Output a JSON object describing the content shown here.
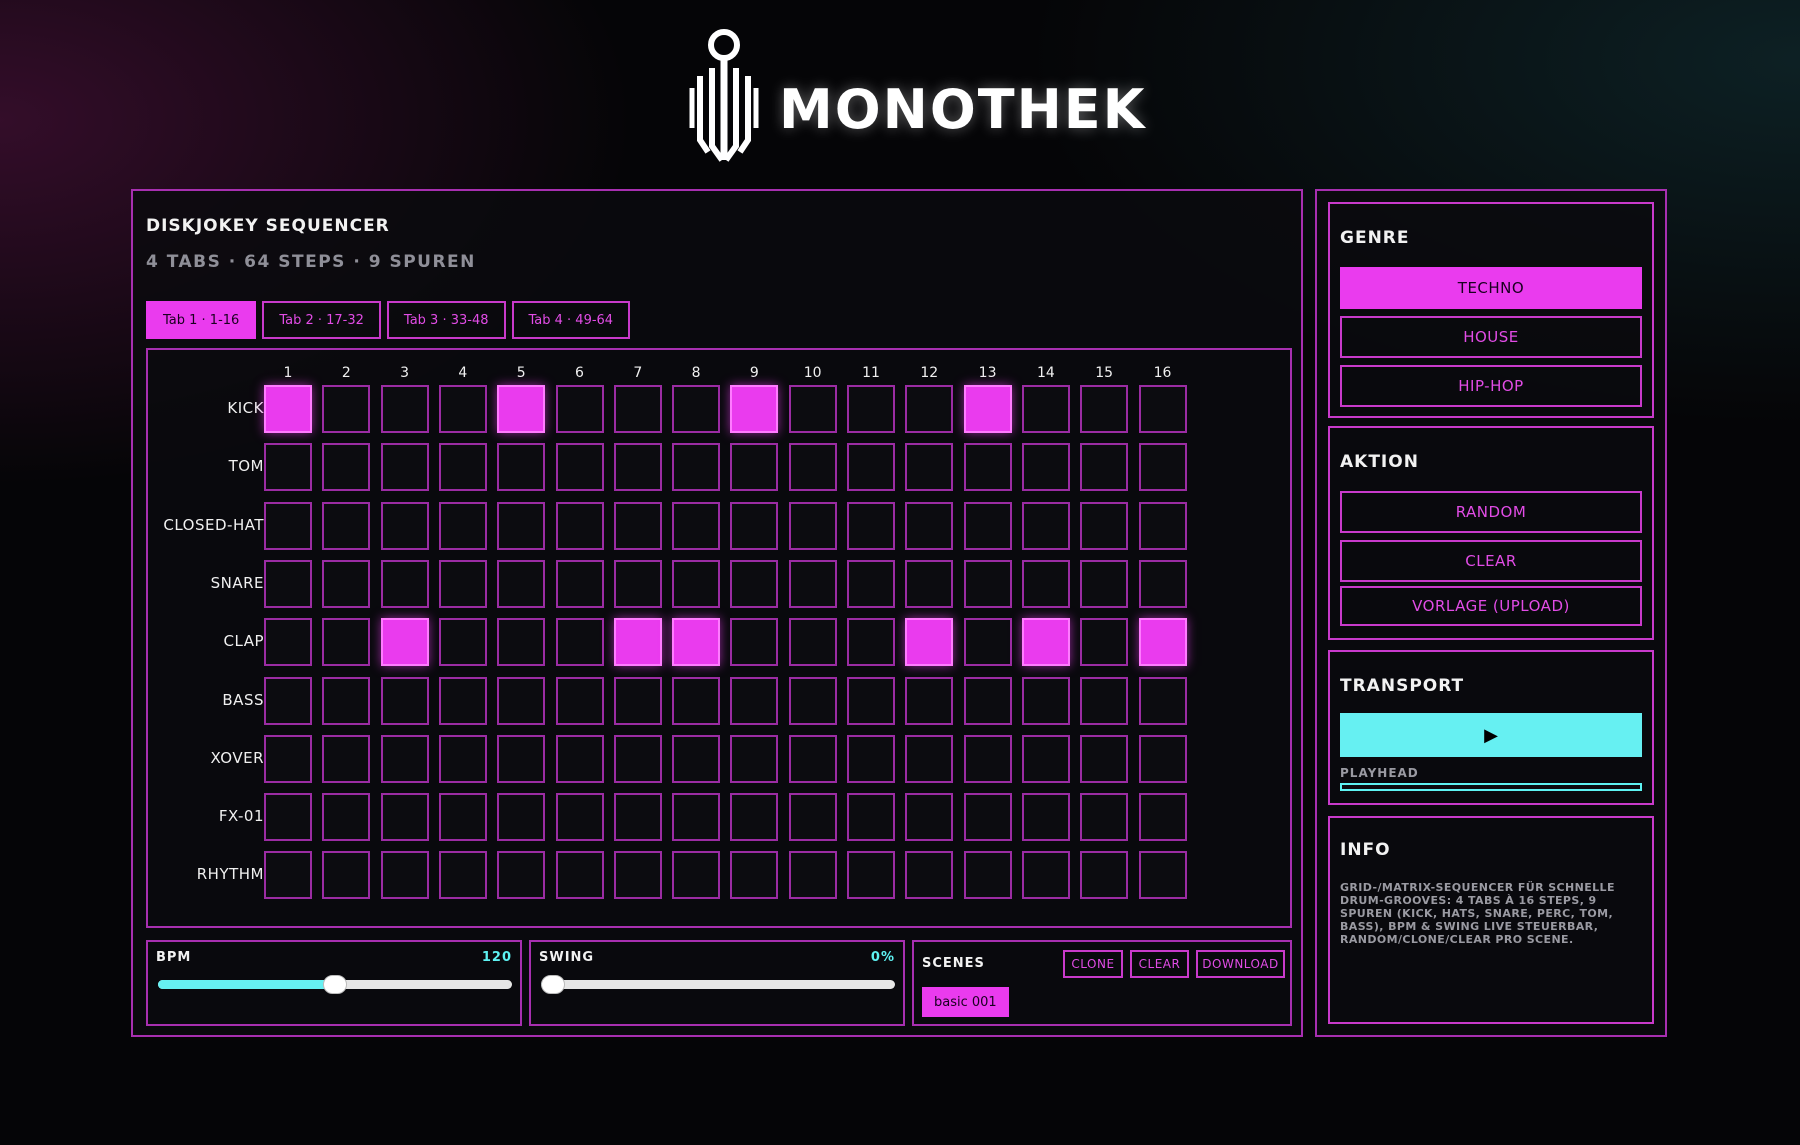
{
  "brand": {
    "name": "MONOTHEK"
  },
  "sequencer": {
    "title": "DISKJOKEY SEQUENCER",
    "subtitle": "4 TABS · 64 STEPS · 9 SPUREN",
    "tabs": [
      {
        "label": "Tab 1 · 1-16",
        "active": true
      },
      {
        "label": "Tab 2 · 17-32",
        "active": false
      },
      {
        "label": "Tab 3 · 33-48",
        "active": false
      },
      {
        "label": "Tab 4 · 49-64",
        "active": false
      }
    ],
    "steps": [
      "1",
      "2",
      "3",
      "4",
      "5",
      "6",
      "7",
      "8",
      "9",
      "10",
      "11",
      "12",
      "13",
      "14",
      "15",
      "16"
    ],
    "tracks": [
      {
        "name": "KICK",
        "pattern": [
          1,
          0,
          0,
          0,
          1,
          0,
          0,
          0,
          1,
          0,
          0,
          0,
          1,
          0,
          0,
          0
        ]
      },
      {
        "name": "TOM",
        "pattern": [
          0,
          0,
          0,
          0,
          0,
          0,
          0,
          0,
          0,
          0,
          0,
          0,
          0,
          0,
          0,
          0
        ]
      },
      {
        "name": "CLOSED-HAT",
        "pattern": [
          0,
          0,
          0,
          0,
          0,
          0,
          0,
          0,
          0,
          0,
          0,
          0,
          0,
          0,
          0,
          0
        ]
      },
      {
        "name": "SNARE",
        "pattern": [
          0,
          0,
          0,
          0,
          0,
          0,
          0,
          0,
          0,
          0,
          0,
          0,
          0,
          0,
          0,
          0
        ]
      },
      {
        "name": "CLAP",
        "pattern": [
          0,
          0,
          1,
          0,
          0,
          0,
          1,
          1,
          0,
          0,
          0,
          1,
          0,
          1,
          0,
          1
        ]
      },
      {
        "name": "BASS",
        "pattern": [
          0,
          0,
          0,
          0,
          0,
          0,
          0,
          0,
          0,
          0,
          0,
          0,
          0,
          0,
          0,
          0
        ]
      },
      {
        "name": "XOVER",
        "pattern": [
          0,
          0,
          0,
          0,
          0,
          0,
          0,
          0,
          0,
          0,
          0,
          0,
          0,
          0,
          0,
          0
        ]
      },
      {
        "name": "FX-01",
        "pattern": [
          0,
          0,
          0,
          0,
          0,
          0,
          0,
          0,
          0,
          0,
          0,
          0,
          0,
          0,
          0,
          0
        ]
      },
      {
        "name": "RHYTHM",
        "pattern": [
          0,
          0,
          0,
          0,
          0,
          0,
          0,
          0,
          0,
          0,
          0,
          0,
          0,
          0,
          0,
          0
        ]
      }
    ]
  },
  "bpm": {
    "label": "BPM",
    "value": "120",
    "fraction": 0.5
  },
  "swing": {
    "label": "SWING",
    "value": "0%",
    "fraction": 0.0
  },
  "scenes": {
    "title": "SCENES",
    "clone_label": "CLONE",
    "clear_label": "CLEAR",
    "download_label": "DOWNLOAD",
    "current": "basic 001"
  },
  "genre": {
    "title": "GENRE",
    "options": [
      {
        "label": "TECHNO",
        "active": true
      },
      {
        "label": "HOUSE",
        "active": false
      },
      {
        "label": "HIP-HOP",
        "active": false
      }
    ]
  },
  "aktion": {
    "title": "AKTION",
    "random_label": "RANDOM",
    "clear_label": "CLEAR",
    "template_label": "VORLAGE (UPLOAD)"
  },
  "transport": {
    "title": "TRANSPORT",
    "play_icon": "▶",
    "playhead_label": "PLAYHEAD",
    "playhead_progress": 0.0
  },
  "info": {
    "title": "INFO",
    "text": "GRID-/MATRIX-SEQUENCER FÜR SCHNELLE DRUM-GROOVES: 4 TABS À 16 STEPS, 9 SPUREN (KICK, HATS, SNARE, PERC, TOM, BASS), BPM & SWING LIVE STEUERBAR, RANDOM/CLONE/CLEAR PRO SCENE."
  },
  "colors": {
    "accent": "#ea3bee",
    "cyan": "#66f0f2",
    "border": "#a72fb0"
  }
}
